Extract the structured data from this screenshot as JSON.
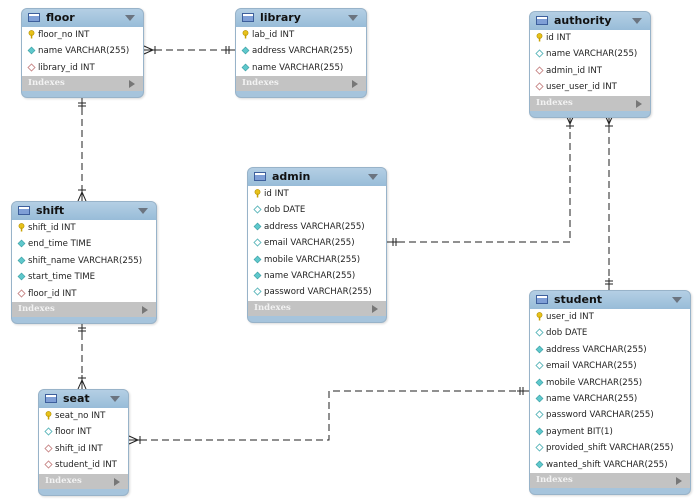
{
  "colors": {
    "header": "#a6c4dc",
    "indexes_bar": "#c3c3c3",
    "pk_key": "#e8c21a",
    "not_null": "#5fc8cc",
    "fk": "#c98a8a"
  },
  "indexes_label": "Indexes",
  "tables": [
    {
      "name": "floor",
      "columns": [
        {
          "text": "floor_no INT",
          "kind": "pk"
        },
        {
          "text": "name VARCHAR(255)",
          "kind": "nn"
        },
        {
          "text": "library_id INT",
          "kind": "fk"
        }
      ]
    },
    {
      "name": "library",
      "columns": [
        {
          "text": "lab_id INT",
          "kind": "pk"
        },
        {
          "text": "address VARCHAR(255)",
          "kind": "nn"
        },
        {
          "text": "name VARCHAR(255)",
          "kind": "nn"
        }
      ]
    },
    {
      "name": "authority",
      "columns": [
        {
          "text": "id INT",
          "kind": "pk"
        },
        {
          "text": "name VARCHAR(255)",
          "kind": "null"
        },
        {
          "text": "admin_id INT",
          "kind": "fk"
        },
        {
          "text": "user_user_id INT",
          "kind": "fk"
        }
      ]
    },
    {
      "name": "admin",
      "columns": [
        {
          "text": "id INT",
          "kind": "pk"
        },
        {
          "text": "dob DATE",
          "kind": "null"
        },
        {
          "text": "address VARCHAR(255)",
          "kind": "nn"
        },
        {
          "text": "email VARCHAR(255)",
          "kind": "null"
        },
        {
          "text": "mobile VARCHAR(255)",
          "kind": "nn"
        },
        {
          "text": "name VARCHAR(255)",
          "kind": "nn"
        },
        {
          "text": "password VARCHAR(255)",
          "kind": "null"
        }
      ]
    },
    {
      "name": "shift",
      "columns": [
        {
          "text": "shift_id INT",
          "kind": "pk"
        },
        {
          "text": "end_time TIME",
          "kind": "nn"
        },
        {
          "text": "shift_name VARCHAR(255)",
          "kind": "nn"
        },
        {
          "text": "start_time TIME",
          "kind": "nn"
        },
        {
          "text": "floor_id INT",
          "kind": "fk"
        }
      ]
    },
    {
      "name": "seat",
      "columns": [
        {
          "text": "seat_no INT",
          "kind": "pk"
        },
        {
          "text": "floor INT",
          "kind": "null"
        },
        {
          "text": "shift_id INT",
          "kind": "fk"
        },
        {
          "text": "student_id INT",
          "kind": "fk"
        }
      ]
    },
    {
      "name": "student",
      "columns": [
        {
          "text": "user_id INT",
          "kind": "pk"
        },
        {
          "text": "dob DATE",
          "kind": "null"
        },
        {
          "text": "address VARCHAR(255)",
          "kind": "nn"
        },
        {
          "text": "email VARCHAR(255)",
          "kind": "null"
        },
        {
          "text": "mobile VARCHAR(255)",
          "kind": "nn"
        },
        {
          "text": "name VARCHAR(255)",
          "kind": "nn"
        },
        {
          "text": "password VARCHAR(255)",
          "kind": "null"
        },
        {
          "text": "payment BIT(1)",
          "kind": "nn"
        },
        {
          "text": "provided_shift VARCHAR(255)",
          "kind": "null"
        },
        {
          "text": "wanted_shift VARCHAR(255)",
          "kind": "nn"
        }
      ]
    }
  ],
  "relationships": [
    {
      "many": "floor",
      "one": "library"
    },
    {
      "many": "shift",
      "one": "floor"
    },
    {
      "many": "seat",
      "one": "shift"
    },
    {
      "many": "authority",
      "one": "admin"
    },
    {
      "many": "authority",
      "one": "student"
    },
    {
      "many": "seat",
      "one": "student"
    }
  ]
}
